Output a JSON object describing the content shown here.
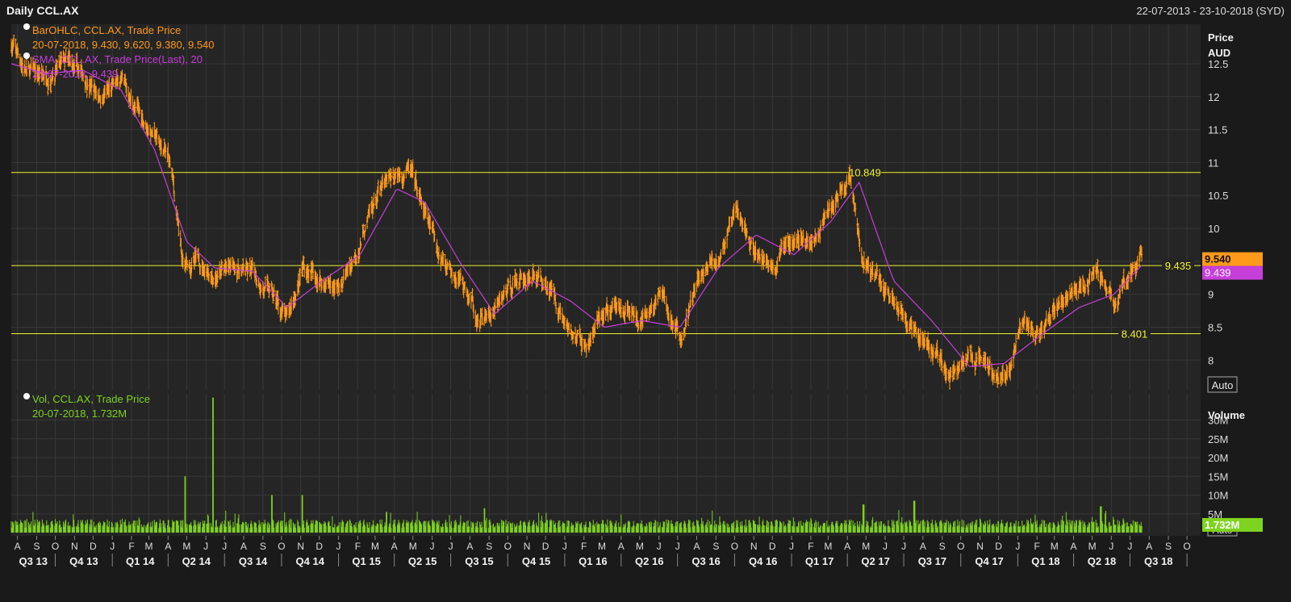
{
  "header": {
    "title": "Daily CCL.AX",
    "date_range": "22-07-2013 - 23-10-2018 (SYD)"
  },
  "colors": {
    "background": "#1a1a1a",
    "panel": "#252525",
    "grid": "#383838",
    "price_bars": "#ff9a1a",
    "sma": "#c63fd8",
    "volume": "#7ed321",
    "levels": "#f1f230",
    "text": "#dcdcdc"
  },
  "legend": {
    "price": {
      "line1": "BarOHLC, CCL.AX, Trade Price",
      "line2": "20-07-2018, 9.430, 9.620, 9.380, 9.540"
    },
    "sma": {
      "line1": "SMA, CCL.AX, Trade Price(Last),  20",
      "line2": "20-07-2018, 9.439"
    },
    "volume": {
      "line1": "Vol, CCL.AX, Trade Price",
      "line2": "20-07-2018, 1.732M"
    }
  },
  "chart_data": [
    {
      "type": "line",
      "panel": "price",
      "axis_title": "Price",
      "axis_unit": "AUD",
      "y_ticks": [
        "12.5",
        "12",
        "11.5",
        "11",
        "10.5",
        "10",
        "9.5",
        "9",
        "8.5",
        "8"
      ],
      "ylim": [
        7.55,
        13.1
      ],
      "x_range": [
        "2013-07-22",
        "2018-10-23"
      ],
      "grid": true,
      "series": [
        {
          "name": "BarOHLC, CCL.AX, Trade Price",
          "x": [
            "2013-07-22",
            "2013-08-15",
            "2013-09-15",
            "2013-10-15",
            "2013-11-15",
            "2013-12-15",
            "2014-01-15",
            "2014-02-10",
            "2014-03-10",
            "2014-04-05",
            "2014-04-25",
            "2014-05-20",
            "2014-06-15",
            "2014-07-15",
            "2014-08-15",
            "2014-09-15",
            "2014-10-10",
            "2014-11-05",
            "2014-12-05",
            "2015-01-05",
            "2015-02-05",
            "2015-03-05",
            "2015-04-05",
            "2015-04-25",
            "2015-05-20",
            "2015-06-15",
            "2015-07-15",
            "2015-08-15",
            "2015-09-10",
            "2015-10-10",
            "2015-11-10",
            "2015-12-10",
            "2016-01-10",
            "2016-02-05",
            "2016-03-05",
            "2016-04-05",
            "2016-05-05",
            "2016-06-05",
            "2016-07-05",
            "2016-08-05",
            "2016-09-05",
            "2016-10-05",
            "2016-11-05",
            "2016-12-05",
            "2017-01-05",
            "2017-02-05",
            "2017-03-05",
            "2017-04-05",
            "2017-04-25",
            "2017-05-15",
            "2017-06-15",
            "2017-07-15",
            "2017-08-15",
            "2017-09-15",
            "2017-10-15",
            "2017-11-15",
            "2017-12-10",
            "2018-01-10",
            "2018-02-10",
            "2018-03-10",
            "2018-04-10",
            "2018-05-10",
            "2018-06-05",
            "2018-07-05",
            "2018-07-20"
          ],
          "values": [
            12.8,
            12.4,
            12.3,
            12.5,
            12.3,
            12.0,
            12.2,
            11.8,
            11.4,
            11.0,
            9.4,
            9.5,
            9.3,
            9.4,
            9.3,
            9.0,
            8.6,
            9.4,
            9.2,
            9.1,
            9.8,
            10.5,
            10.8,
            10.9,
            10.2,
            9.6,
            9.3,
            8.6,
            8.7,
            9.2,
            9.3,
            9.1,
            8.4,
            8.2,
            8.7,
            8.8,
            8.5,
            9.0,
            8.3,
            9.2,
            9.6,
            10.2,
            9.6,
            9.4,
            10.0,
            9.8,
            10.3,
            10.8,
            9.5,
            9.3,
            8.9,
            8.5,
            8.2,
            7.8,
            8.0,
            8.0,
            7.7,
            8.6,
            8.3,
            8.9,
            9.0,
            9.4,
            8.9,
            9.3,
            9.54
          ]
        },
        {
          "name": "SMA, CCL.AX, Trade Price(Last),  20",
          "x": [
            "2013-07-22",
            "2013-09-15",
            "2013-11-15",
            "2014-01-15",
            "2014-03-10",
            "2014-05-01",
            "2014-06-15",
            "2014-08-15",
            "2014-10-10",
            "2014-12-05",
            "2015-02-05",
            "2015-04-05",
            "2015-05-20",
            "2015-07-15",
            "2015-09-10",
            "2015-11-10",
            "2016-01-10",
            "2016-03-05",
            "2016-05-05",
            "2016-07-05",
            "2016-09-05",
            "2016-11-05",
            "2017-01-05",
            "2017-03-05",
            "2017-04-20",
            "2017-06-15",
            "2017-08-15",
            "2017-10-15",
            "2017-12-10",
            "2018-02-10",
            "2018-04-10",
            "2018-06-05",
            "2018-07-20"
          ],
          "values": [
            12.5,
            12.35,
            12.4,
            12.1,
            11.2,
            9.8,
            9.4,
            9.35,
            8.8,
            9.2,
            9.6,
            10.6,
            10.4,
            9.5,
            8.7,
            9.2,
            8.9,
            8.5,
            8.6,
            8.5,
            9.4,
            9.9,
            9.6,
            10.1,
            10.7,
            9.2,
            8.6,
            7.9,
            7.95,
            8.4,
            8.8,
            9.0,
            9.439
          ]
        }
      ],
      "levels": [
        {
          "value": 10.849,
          "label": "10.849"
        },
        {
          "value": 9.435,
          "label": "9.435"
        },
        {
          "value": 8.401,
          "label": "8.401"
        }
      ],
      "last_value_labels": [
        {
          "value": 9.54,
          "label": "9.540",
          "color": "#ff9a1a"
        },
        {
          "value": 9.439,
          "label": "9.439",
          "color": "#c63fd8"
        }
      ],
      "auto_label": "Auto"
    },
    {
      "type": "bar",
      "panel": "volume",
      "axis_title": "Volume",
      "y_ticks": [
        "30M",
        "25M",
        "20M",
        "15M",
        "10M",
        "5M"
      ],
      "ylim": [
        0,
        37
      ],
      "series": [
        {
          "name": "Vol, CCL.AX, Trade Price",
          "x": [
            "2014-04-28",
            "2014-06-13",
            "2014-09-15",
            "2014-11-03",
            "2015-03-20",
            "2015-08-24",
            "2017-04-27",
            "2017-07-18",
            "2018-05-15"
          ],
          "values": [
            15,
            36,
            10,
            10,
            5.5,
            6.5,
            7.5,
            8.5,
            7
          ],
          "typical_daily": 2.5
        }
      ],
      "last_value_label": {
        "value": 1.732,
        "label": "1.732M"
      },
      "auto_label": "Auto"
    }
  ],
  "x_axis": {
    "months": [
      {
        "label": "A",
        "date": "2013-08-01"
      },
      {
        "label": "S",
        "date": "2013-09-01"
      },
      {
        "label": "O",
        "date": "2013-10-01"
      },
      {
        "label": "N",
        "date": "2013-11-01"
      },
      {
        "label": "D",
        "date": "2013-12-01"
      },
      {
        "label": "J",
        "date": "2014-01-01"
      },
      {
        "label": "F",
        "date": "2014-02-01"
      },
      {
        "label": "M",
        "date": "2014-03-01"
      },
      {
        "label": "A",
        "date": "2014-04-01"
      },
      {
        "label": "M",
        "date": "2014-05-01"
      },
      {
        "label": "J",
        "date": "2014-06-01"
      },
      {
        "label": "J",
        "date": "2014-07-01"
      },
      {
        "label": "A",
        "date": "2014-08-01"
      },
      {
        "label": "S",
        "date": "2014-09-01"
      },
      {
        "label": "O",
        "date": "2014-10-01"
      },
      {
        "label": "N",
        "date": "2014-11-01"
      },
      {
        "label": "D",
        "date": "2014-12-01"
      },
      {
        "label": "J",
        "date": "2015-01-01"
      },
      {
        "label": "F",
        "date": "2015-02-01"
      },
      {
        "label": "M",
        "date": "2015-03-01"
      },
      {
        "label": "A",
        "date": "2015-04-01"
      },
      {
        "label": "M",
        "date": "2015-05-01"
      },
      {
        "label": "J",
        "date": "2015-06-01"
      },
      {
        "label": "J",
        "date": "2015-07-01"
      },
      {
        "label": "A",
        "date": "2015-08-01"
      },
      {
        "label": "S",
        "date": "2015-09-01"
      },
      {
        "label": "O",
        "date": "2015-10-01"
      },
      {
        "label": "N",
        "date": "2015-11-01"
      },
      {
        "label": "D",
        "date": "2015-12-01"
      },
      {
        "label": "J",
        "date": "2016-01-01"
      },
      {
        "label": "F",
        "date": "2016-02-01"
      },
      {
        "label": "M",
        "date": "2016-03-01"
      },
      {
        "label": "A",
        "date": "2016-04-01"
      },
      {
        "label": "M",
        "date": "2016-05-01"
      },
      {
        "label": "J",
        "date": "2016-06-01"
      },
      {
        "label": "J",
        "date": "2016-07-01"
      },
      {
        "label": "A",
        "date": "2016-08-01"
      },
      {
        "label": "S",
        "date": "2016-09-01"
      },
      {
        "label": "O",
        "date": "2016-10-01"
      },
      {
        "label": "N",
        "date": "2016-11-01"
      },
      {
        "label": "D",
        "date": "2016-12-01"
      },
      {
        "label": "J",
        "date": "2017-01-01"
      },
      {
        "label": "F",
        "date": "2017-02-01"
      },
      {
        "label": "M",
        "date": "2017-03-01"
      },
      {
        "label": "A",
        "date": "2017-04-01"
      },
      {
        "label": "M",
        "date": "2017-05-01"
      },
      {
        "label": "J",
        "date": "2017-06-01"
      },
      {
        "label": "J",
        "date": "2017-07-01"
      },
      {
        "label": "A",
        "date": "2017-08-01"
      },
      {
        "label": "S",
        "date": "2017-09-01"
      },
      {
        "label": "O",
        "date": "2017-10-01"
      },
      {
        "label": "N",
        "date": "2017-11-01"
      },
      {
        "label": "D",
        "date": "2017-12-01"
      },
      {
        "label": "J",
        "date": "2018-01-01"
      },
      {
        "label": "F",
        "date": "2018-02-01"
      },
      {
        "label": "M",
        "date": "2018-03-01"
      },
      {
        "label": "A",
        "date": "2018-04-01"
      },
      {
        "label": "M",
        "date": "2018-05-01"
      },
      {
        "label": "J",
        "date": "2018-06-01"
      },
      {
        "label": "J",
        "date": "2018-07-01"
      },
      {
        "label": "A",
        "date": "2018-08-01"
      },
      {
        "label": "S",
        "date": "2018-09-01"
      },
      {
        "label": "O",
        "date": "2018-10-01"
      }
    ],
    "quarters": [
      {
        "label": "Q3 13",
        "start": "2013-07-22",
        "end": "2013-10-01"
      },
      {
        "label": "Q4 13",
        "start": "2013-10-01",
        "end": "2014-01-01"
      },
      {
        "label": "Q1 14",
        "start": "2014-01-01",
        "end": "2014-04-01"
      },
      {
        "label": "Q2 14",
        "start": "2014-04-01",
        "end": "2014-07-01"
      },
      {
        "label": "Q3 14",
        "start": "2014-07-01",
        "end": "2014-10-01"
      },
      {
        "label": "Q4 14",
        "start": "2014-10-01",
        "end": "2015-01-01"
      },
      {
        "label": "Q1 15",
        "start": "2015-01-01",
        "end": "2015-04-01"
      },
      {
        "label": "Q2 15",
        "start": "2015-04-01",
        "end": "2015-07-01"
      },
      {
        "label": "Q3 15",
        "start": "2015-07-01",
        "end": "2015-10-01"
      },
      {
        "label": "Q4 15",
        "start": "2015-10-01",
        "end": "2016-01-01"
      },
      {
        "label": "Q1 16",
        "start": "2016-01-01",
        "end": "2016-04-01"
      },
      {
        "label": "Q2 16",
        "start": "2016-04-01",
        "end": "2016-07-01"
      },
      {
        "label": "Q3 16",
        "start": "2016-07-01",
        "end": "2016-10-01"
      },
      {
        "label": "Q4 16",
        "start": "2016-10-01",
        "end": "2017-01-01"
      },
      {
        "label": "Q1 17",
        "start": "2017-01-01",
        "end": "2017-04-01"
      },
      {
        "label": "Q2 17",
        "start": "2017-04-01",
        "end": "2017-07-01"
      },
      {
        "label": "Q3 17",
        "start": "2017-07-01",
        "end": "2017-10-01"
      },
      {
        "label": "Q4 17",
        "start": "2017-10-01",
        "end": "2018-01-01"
      },
      {
        "label": "Q1 18",
        "start": "2018-01-01",
        "end": "2018-04-01"
      },
      {
        "label": "Q2 18",
        "start": "2018-04-01",
        "end": "2018-07-01"
      },
      {
        "label": "Q3 18",
        "start": "2018-07-01",
        "end": "2018-10-01"
      }
    ]
  }
}
